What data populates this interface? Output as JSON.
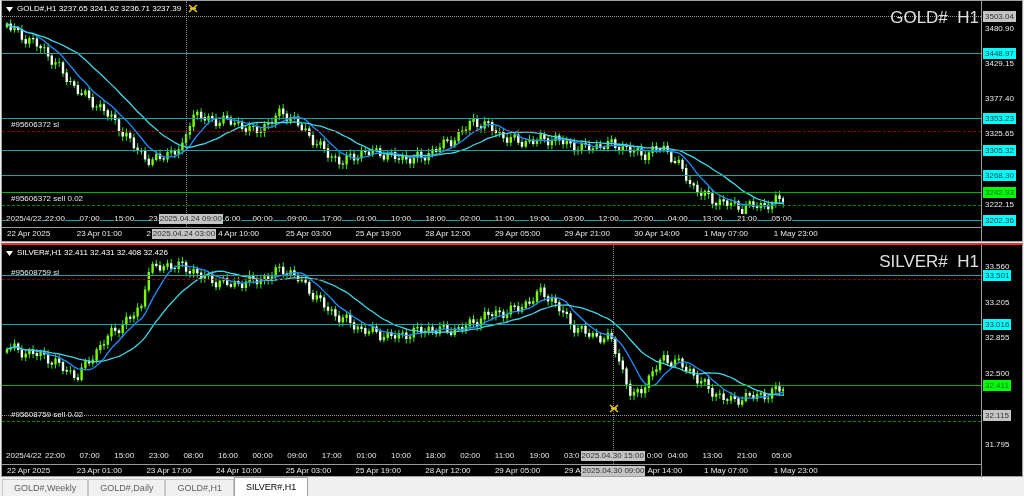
{
  "panes": [
    {
      "symbol_line": "GOLD#,H1 3237.65 3241.62 3236.71 3237.39",
      "title": "GOLD#  H1",
      "active": false,
      "price_labels": [
        {
          "text": "3503.04",
          "kind": "marker"
        },
        {
          "text": "3480.90",
          "kind": "tick"
        },
        {
          "text": "3448.97",
          "kind": "line"
        },
        {
          "text": "3429.15",
          "kind": "tick"
        },
        {
          "text": "3377.40",
          "kind": "tick"
        },
        {
          "text": "3353.23",
          "kind": "line"
        },
        {
          "text": "3325.65",
          "kind": "tick"
        },
        {
          "text": "3305.32",
          "kind": "line"
        },
        {
          "text": "3268.30",
          "kind": "line"
        },
        {
          "text": "3242.93",
          "kind": "bid"
        },
        {
          "text": "3222.15",
          "kind": "tick"
        },
        {
          "text": "3202.36",
          "kind": "line"
        }
      ],
      "orders": [
        {
          "text": "#95606372 sl",
          "kind": "sl"
        },
        {
          "text": "#95606372 sell 0.02",
          "kind": "sell"
        }
      ],
      "time_row_1": [
        {
          "text": "2025/4/22",
          "kind": "date"
        },
        {
          "text": "22:00",
          "kind": "tick"
        },
        {
          "text": "07:00",
          "kind": "tick"
        },
        {
          "text": "15:00",
          "kind": "tick"
        },
        {
          "text": "23",
          "kind": "tick"
        },
        {
          "text": "2025.04.24 09:00",
          "kind": "cursor"
        },
        {
          "text": "6:00",
          "kind": "clipped"
        },
        {
          "text": "00:00",
          "kind": "tick"
        },
        {
          "text": "09:00",
          "kind": "tick"
        },
        {
          "text": "17:00",
          "kind": "tick"
        },
        {
          "text": "01:00",
          "kind": "tick"
        },
        {
          "text": "10:00",
          "kind": "tick"
        },
        {
          "text": "18:00",
          "kind": "tick"
        },
        {
          "text": "02:00",
          "kind": "tick"
        },
        {
          "text": "11:00",
          "kind": "tick"
        },
        {
          "text": "19:00",
          "kind": "tick"
        },
        {
          "text": "03:00",
          "kind": "tick"
        },
        {
          "text": "12:00",
          "kind": "tick"
        },
        {
          "text": "20:00",
          "kind": "tick"
        },
        {
          "text": "04:00",
          "kind": "tick"
        },
        {
          "text": "13:00",
          "kind": "tick"
        },
        {
          "text": "21:00",
          "kind": "tick"
        },
        {
          "text": "05:00",
          "kind": "tick"
        }
      ],
      "time_row_2": [
        {
          "text": "22 Apr 2025",
          "kind": "tick"
        },
        {
          "text": "23 Apr 01:00",
          "kind": "tick"
        },
        {
          "text": "2",
          "kind": "tick"
        },
        {
          "text": "2025.04.24 03:00",
          "kind": "cursor"
        },
        {
          "text": "4 Apr 10:00",
          "kind": "clipped"
        },
        {
          "text": "25 Apr 03:00",
          "kind": "tick"
        },
        {
          "text": "25 Apr 19:00",
          "kind": "tick"
        },
        {
          "text": "28 Apr 12:00",
          "kind": "tick"
        },
        {
          "text": "29 Apr 05:00",
          "kind": "tick"
        },
        {
          "text": "29 Apr 21:00",
          "kind": "tick"
        },
        {
          "text": "30 Apr 14:00",
          "kind": "tick"
        },
        {
          "text": "1 May 07:00",
          "kind": "tick"
        },
        {
          "text": "1 May 23:00",
          "kind": "tick"
        }
      ]
    },
    {
      "symbol_line": "SILVER#,H1 32.411 32.431 32.408 32.426",
      "title": "SILVER#  H1",
      "active": true,
      "price_labels": [
        {
          "text": "33.560",
          "kind": "tick"
        },
        {
          "text": "33.501",
          "kind": "line"
        },
        {
          "text": "33.205",
          "kind": "tick"
        },
        {
          "text": "33.016",
          "kind": "line"
        },
        {
          "text": "32.855",
          "kind": "tick"
        },
        {
          "text": "32.500",
          "kind": "tick"
        },
        {
          "text": "32.411",
          "kind": "bid"
        },
        {
          "text": "32.115",
          "kind": "marker"
        },
        {
          "text": "31.795",
          "kind": "tick"
        }
      ],
      "orders": [
        {
          "text": "#95608759 sl",
          "kind": "sl"
        },
        {
          "text": "#95608759 sell 0.02",
          "kind": "sell"
        }
      ],
      "time_row_1": [
        {
          "text": "2025/4/22",
          "kind": "date"
        },
        {
          "text": "22:00",
          "kind": "tick"
        },
        {
          "text": "07:00",
          "kind": "tick"
        },
        {
          "text": "15:00",
          "kind": "tick"
        },
        {
          "text": "23:00",
          "kind": "tick"
        },
        {
          "text": "08:00",
          "kind": "tick"
        },
        {
          "text": "16:00",
          "kind": "tick"
        },
        {
          "text": "00:00",
          "kind": "tick"
        },
        {
          "text": "09:00",
          "kind": "tick"
        },
        {
          "text": "17:00",
          "kind": "tick"
        },
        {
          "text": "01:00",
          "kind": "tick"
        },
        {
          "text": "10:00",
          "kind": "tick"
        },
        {
          "text": "18:00",
          "kind": "tick"
        },
        {
          "text": "02:00",
          "kind": "tick"
        },
        {
          "text": "11:00",
          "kind": "tick"
        },
        {
          "text": "19:00",
          "kind": "tick"
        },
        {
          "text": "03:0",
          "kind": "tick"
        },
        {
          "text": "2025.04.30 15:00",
          "kind": "cursor"
        },
        {
          "text": "0:00",
          "kind": "clipped"
        },
        {
          "text": "04:00",
          "kind": "tick"
        },
        {
          "text": "13:00",
          "kind": "tick"
        },
        {
          "text": "21:00",
          "kind": "tick"
        },
        {
          "text": "05:00",
          "kind": "tick"
        }
      ],
      "time_row_2": [
        {
          "text": "22 Apr 2025",
          "kind": "tick"
        },
        {
          "text": "23 Apr 01:00",
          "kind": "tick"
        },
        {
          "text": "23 Apr 17:00",
          "kind": "tick"
        },
        {
          "text": "24 Apr 10:00",
          "kind": "tick"
        },
        {
          "text": "25 Apr 03:00",
          "kind": "tick"
        },
        {
          "text": "25 Apr 19:00",
          "kind": "tick"
        },
        {
          "text": "28 Apr 12:00",
          "kind": "tick"
        },
        {
          "text": "29 Apr 05:00",
          "kind": "tick"
        },
        {
          "text": "29 A",
          "kind": "tick"
        },
        {
          "text": "2025.04.30 09:00",
          "kind": "cursor"
        },
        {
          "text": "Apr 14:00",
          "kind": "clipped"
        },
        {
          "text": "1 May 07:00",
          "kind": "tick"
        },
        {
          "text": "1 May 23:00",
          "kind": "tick"
        }
      ]
    }
  ],
  "tabs": [
    {
      "label": "GOLD#,Weekly",
      "selected": false
    },
    {
      "label": "GOLD#,Daily",
      "selected": false
    },
    {
      "label": "GOLD#,H1",
      "selected": false
    },
    {
      "label": "SILVER#,H1",
      "selected": true
    }
  ]
}
